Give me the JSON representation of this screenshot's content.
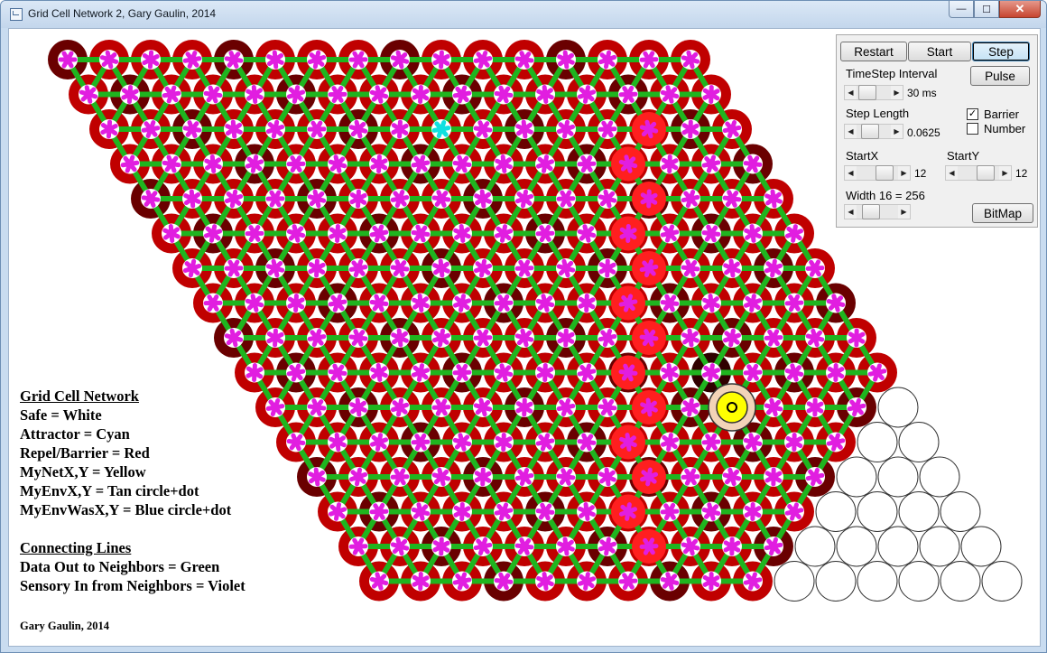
{
  "window": {
    "title": "Grid Cell Network 2, Gary Gaulin, 2014",
    "controls": {
      "minimize": "—",
      "maximize": "☐",
      "close": "✕"
    }
  },
  "panel": {
    "buttons": {
      "restart": "Restart",
      "start": "Start",
      "step": "Step",
      "pulse": "Pulse",
      "bitmap": "BitMap"
    },
    "timestep_label": "TimeStep Interval",
    "timestep_value": "30 ms",
    "step_length_label": "Step Length",
    "step_length_value": "0.0625",
    "barrier_label": "Barrier",
    "barrier_checked": true,
    "number_label": "Number",
    "number_checked": false,
    "startx_label": "StartX",
    "startx_value": "12",
    "starty_label": "StartY",
    "starty_value": "12",
    "width_label": "Width 16 = 256",
    "sliders": {
      "timestep": 0.12,
      "step_length": 0.25,
      "startx": 0.75,
      "starty": 0.75,
      "width": 0.2
    }
  },
  "legend": {
    "title": "Grid Cell Network",
    "items": [
      "Safe = White",
      "Attractor = Cyan",
      "Repel/Barrier = Red",
      "MyNetX,Y = Yellow",
      "MyEnvX,Y = Tan circle+dot",
      "MyEnvWasX,Y = Blue circle+dot"
    ],
    "lines_title": "Connecting Lines",
    "lines": [
      "Data Out to Neighbors = Green",
      "Sensory In from Neighbors = Violet"
    ]
  },
  "credit": "Gary Gaulin, 2014",
  "colors": {
    "cell_dark": "#6a0000",
    "cell_red": "#c00000",
    "barrier": "#ff1f1f",
    "green": "#1fb51f",
    "violet": "#e11ee0",
    "cyan": "#11e0e0",
    "yellow": "#ffff00",
    "tan": "#f2d3b8"
  },
  "grid": {
    "rows": 16,
    "cols": 16,
    "barrier_cells": [
      [
        14,
        7
      ],
      [
        13,
        7
      ],
      [
        12,
        8
      ],
      [
        11,
        8
      ],
      [
        10,
        9
      ],
      [
        9,
        9
      ],
      [
        8,
        10
      ],
      [
        7,
        10
      ],
      [
        6,
        11
      ],
      [
        5,
        11
      ],
      [
        4,
        12
      ],
      [
        3,
        12
      ],
      [
        2,
        13
      ]
    ],
    "attractor_cell": [
      2,
      8
    ],
    "safe_region_start_row": 10,
    "yellow_cell": [
      10,
      11
    ],
    "dark_cell": [
      9,
      11
    ]
  }
}
